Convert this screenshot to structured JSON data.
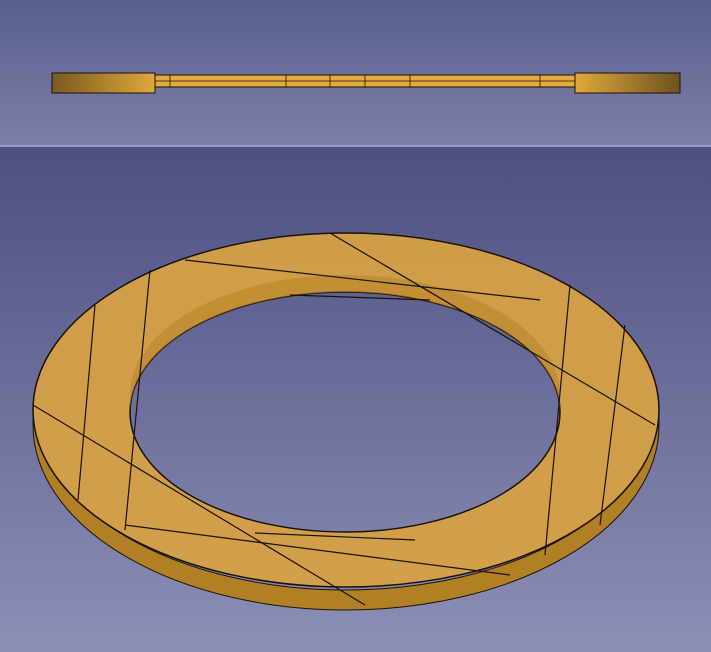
{
  "colors": {
    "part_fill": "#d9a23a",
    "part_dark": "#a8741c",
    "edge": "#1a1208",
    "background_top": "#4d5080",
    "background_bottom": "#8c8fb6"
  }
}
